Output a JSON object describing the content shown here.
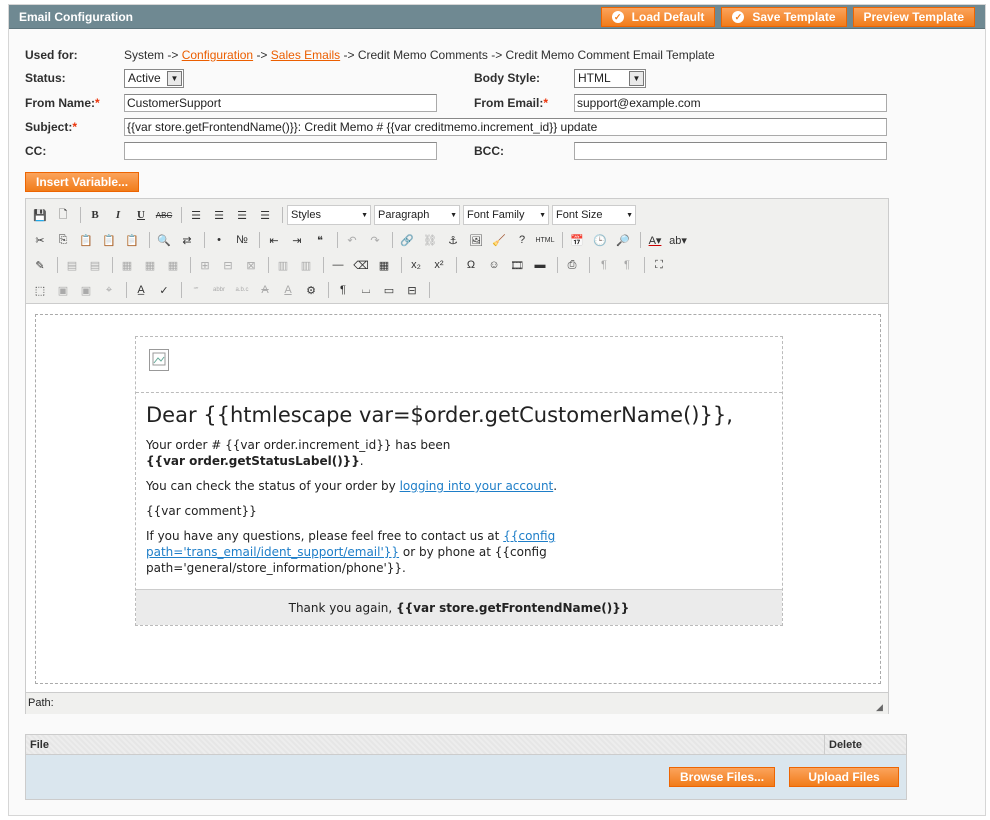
{
  "header": {
    "title": "Email Configuration",
    "load_default": "Load Default",
    "save_template": "Save Template",
    "preview_template": "Preview Template"
  },
  "form": {
    "used_for_label": "Used for:",
    "used_for_prefix": "System ->",
    "used_for_link1": "Configuration",
    "used_for_sep1": "->",
    "used_for_link2": "Sales Emails",
    "used_for_suffix": "-> Credit Memo Comments -> Credit Memo Comment Email Template",
    "status_label": "Status:",
    "status_value": "Active",
    "body_style_label": "Body Style:",
    "body_style_value": "HTML",
    "from_name_label": "From Name:",
    "from_name_value": "CustomerSupport",
    "from_email_label": "From Email:",
    "from_email_value": "support@example.com",
    "subject_label": "Subject:",
    "subject_value": "{{var store.getFrontendName()}}: Credit Memo # {{var creditmemo.increment_id}} update",
    "cc_label": "CC:",
    "cc_value": "",
    "bcc_label": "BCC:",
    "bcc_value": "",
    "required_mark": "*",
    "insert_variable": "Insert Variable..."
  },
  "toolbar": {
    "styles": "Styles",
    "paragraph": "Paragraph",
    "font_family": "Font Family",
    "font_size": "Font Size",
    "bold": "B",
    "italic": "I",
    "underline": "U",
    "strike": "ABC",
    "html": "HTML"
  },
  "email": {
    "greeting": "Dear {{htmlescape var=$order.getCustomerName()}},",
    "line1": "Your order # {{var order.increment_id}} has been",
    "line1_bold": "{{var order.getStatusLabel()}}",
    "line1_end": ".",
    "line2_prefix": "You can check the status of your order by",
    "line2_link": "logging into your account",
    "line2_end": ".",
    "comment": "{{var comment}}",
    "line4_prefix": "If you have any questions, please feel free to contact us at",
    "line4_link": "{{config path='trans_email/ident_support/email'}}",
    "line4_suffix": "or by phone at {{config path='general/store_information/phone'}}.",
    "footer_prefix": "Thank you again,",
    "footer_bold": "{{var store.getFrontendName()}}"
  },
  "editor": {
    "path_label": "Path:"
  },
  "files": {
    "col_file": "File",
    "col_delete": "Delete",
    "browse": "Browse Files...",
    "upload": "Upload Files"
  }
}
